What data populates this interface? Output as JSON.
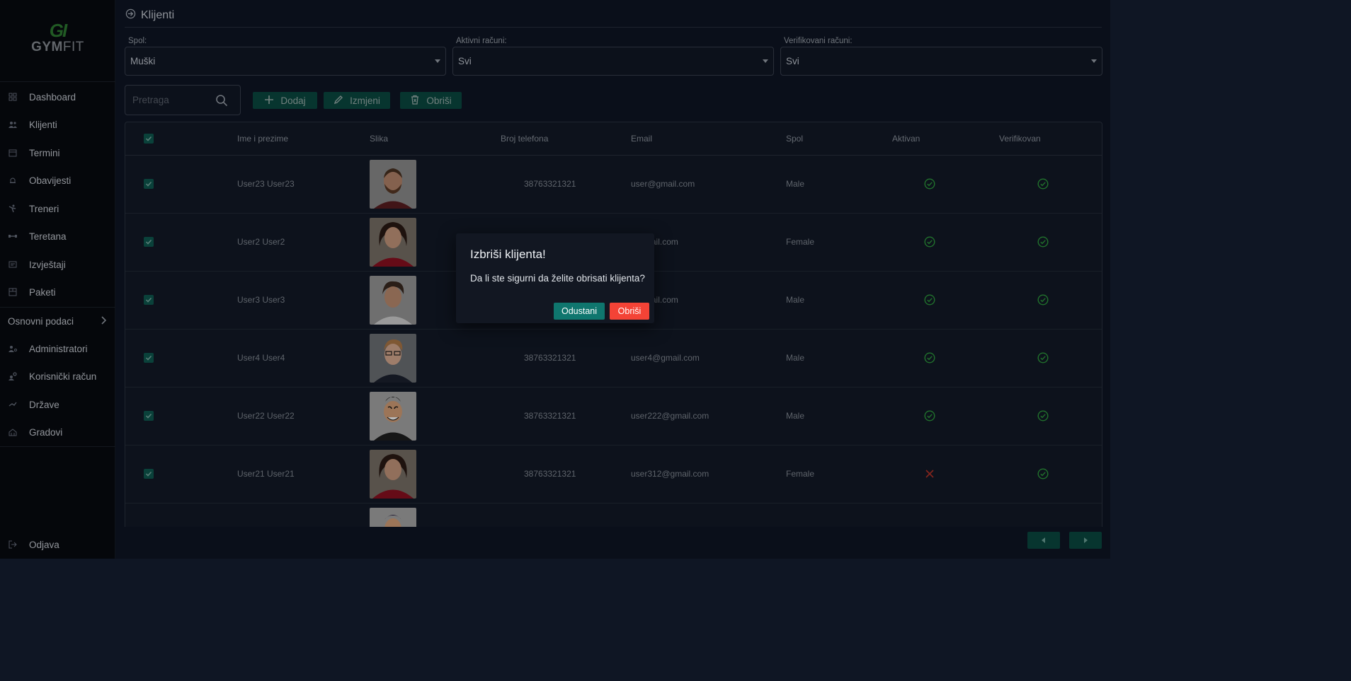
{
  "logo": {
    "mark": "GI",
    "text_bold": "GYM",
    "text_light": "FIT"
  },
  "nav": [
    {
      "label": "Dashboard",
      "icon": "dashboard-icon"
    },
    {
      "label": "Klijenti",
      "icon": "users-icon"
    },
    {
      "label": "Termini",
      "icon": "calendar-icon"
    },
    {
      "label": "Obavijesti",
      "icon": "bell-icon"
    },
    {
      "label": "Treneri",
      "icon": "trainer-icon"
    },
    {
      "label": "Teretana",
      "icon": "dumbbell-icon"
    },
    {
      "label": "Izvještaji",
      "icon": "report-icon"
    },
    {
      "label": "Paketi",
      "icon": "package-icon"
    }
  ],
  "nav_group": {
    "label": "Osnovni podaci",
    "icon": "chevron-right-icon"
  },
  "nav2": [
    {
      "label": "Administratori",
      "icon": "admin-icon"
    },
    {
      "label": "Korisnički račun",
      "icon": "settings-icon"
    },
    {
      "label": "Države",
      "icon": "flag-icon"
    },
    {
      "label": "Gradovi",
      "icon": "city-icon"
    }
  ],
  "logout": {
    "label": "Odjava",
    "icon": "logout-icon"
  },
  "page": {
    "title": "Klijenti",
    "icon": "login-icon"
  },
  "filters": {
    "spol": {
      "label": "Spol:",
      "value": "Muški"
    },
    "aktivni": {
      "label": "Aktivni računi:",
      "value": "Svi"
    },
    "verifikovani": {
      "label": "Verifikovani računi:",
      "value": "Svi"
    }
  },
  "search": {
    "placeholder": "Pretraga"
  },
  "toolbar": {
    "add": "Dodaj",
    "edit": "Izmjeni",
    "delete": "Obriši"
  },
  "table": {
    "headers": [
      "Ime i prezime",
      "Slika",
      "Broj telefona",
      "Email",
      "Spol",
      "Aktivan",
      "Verifikovan"
    ],
    "rows": [
      {
        "name": "User23 User23",
        "phone": "38763321321",
        "email": "user@gmail.com",
        "gender": "Male",
        "active": true,
        "verified": true
      },
      {
        "name": "User2 User2",
        "phone": "",
        "email": "@gmail.com",
        "gender": "Female",
        "active": true,
        "verified": true
      },
      {
        "name": "User3 User3",
        "phone": "",
        "email": "@gmail.com",
        "gender": "Male",
        "active": true,
        "verified": true
      },
      {
        "name": "User4 User4",
        "phone": "38763321321",
        "email": "user4@gmail.com",
        "gender": "Male",
        "active": true,
        "verified": true
      },
      {
        "name": "User22 User22",
        "phone": "38763321321",
        "email": "user222@gmail.com",
        "gender": "Male",
        "active": true,
        "verified": true
      },
      {
        "name": "User21 User21",
        "phone": "38763321321",
        "email": "user312@gmail.com",
        "gender": "Female",
        "active": false,
        "verified": true
      }
    ]
  },
  "dialog": {
    "title": "Izbriši klijenta!",
    "message": "Da li ste sigurni da želite obrisati klijenta?",
    "cancel": "Odustani",
    "confirm": "Obriši"
  },
  "colors": {
    "accent": "#0f766e",
    "danger": "#f44336",
    "ok": "#2e9e3e",
    "bg": "#0f1624"
  }
}
